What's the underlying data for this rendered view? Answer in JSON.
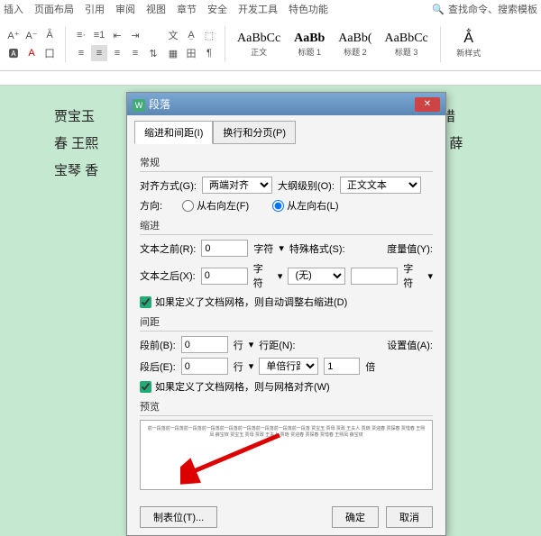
{
  "ribbon": {
    "tabs": [
      "插入",
      "页面布局",
      "引用",
      "审阅",
      "视图",
      "章节",
      "安全",
      "开发工具",
      "特色功能"
    ],
    "search_placeholder": "查找命令、搜索模板",
    "styles": [
      {
        "preview": "AaBbCc",
        "label": "正文"
      },
      {
        "preview": "AaBb",
        "label": "标题 1"
      },
      {
        "preview": "AaBb(",
        "label": "标题 2"
      },
      {
        "preview": "AaBbCc",
        "label": "标题 3"
      }
    ],
    "new_style": "新样式"
  },
  "doc": {
    "line1": "贾宝玉",
    "line1_tail": "贾惜",
    "line2": "春 王熙",
    "line2_tail": "冯 薛",
    "line3": "宝琴 香",
    "line3_tail": ""
  },
  "dialog": {
    "title": "段落",
    "tabs": [
      "缩进和间距(I)",
      "换行和分页(P)"
    ],
    "sec_general": "常规",
    "align_label": "对齐方式(G):",
    "align_value": "两端对齐",
    "outline_label": "大纲级别(O):",
    "outline_value": "正文文本",
    "direction_label": "方向:",
    "dir_rtl": "从右向左(F)",
    "dir_ltr": "从左向右(L)",
    "sec_indent": "缩进",
    "indent_before_label": "文本之前(R):",
    "indent_before_value": "0",
    "char_unit": "字符",
    "special_label": "特殊格式(S):",
    "special_value": "(无)",
    "measure_label": "度量值(Y):",
    "indent_after_label": "文本之后(X):",
    "indent_after_value": "0",
    "chk_grid_indent": "如果定义了文档网格，则自动调整右缩进(D)",
    "sec_spacing": "间距",
    "before_label": "段前(B):",
    "before_value": "0",
    "line_unit": "行",
    "linespacing_label": "行距(N):",
    "linespacing_value": "单倍行距",
    "setvalue_label": "设置值(A):",
    "setvalue_value": "1",
    "times_unit": "倍",
    "after_label": "段后(E):",
    "after_value": "0",
    "chk_grid_align": "如果定义了文档网格，则与网格对齐(W)",
    "sec_preview": "预览",
    "preview_text": "前一段落前一段落前一段落前一段落前一段落前一段落前一段落前一段落前一段落 贾宝玉 贾母 贾政 王夫人 贾琏 贾迎春 贾探春 贾惜春 王熙凤 薛宝钗 贾宝玉 贾母 贾政 王夫人 贾琏 贾迎春 贾探春 贾惜春 王熙凤 薛宝钗",
    "tabs_btn": "制表位(T)...",
    "ok": "确定",
    "cancel": "取消"
  }
}
